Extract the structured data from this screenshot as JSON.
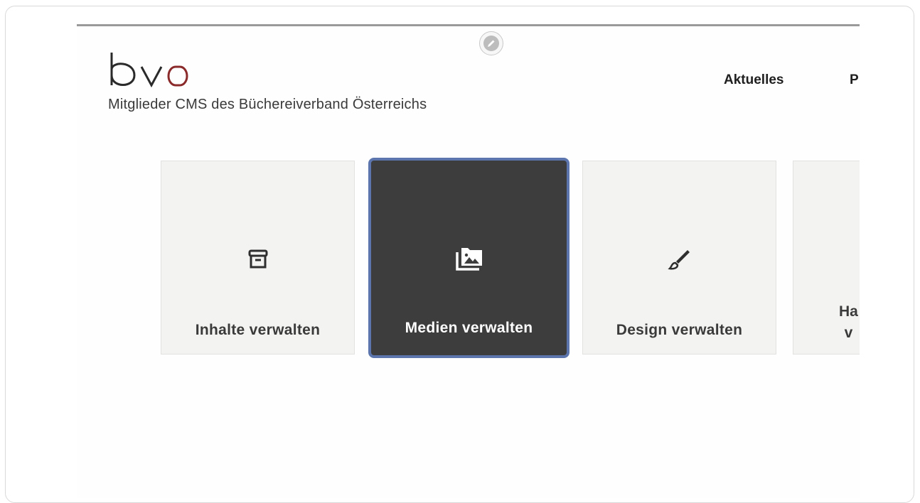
{
  "header": {
    "logo_text": "bvö",
    "subtitle": "Mitglieder CMS des Büchereiverband Österreichs"
  },
  "nav": {
    "items": [
      "Aktuelles",
      "P"
    ]
  },
  "edit_button": {
    "icon": "pencil-icon"
  },
  "tiles": [
    {
      "label": "Inhalte verwalten",
      "icon": "archive-box-icon",
      "selected": false
    },
    {
      "label": "Medien verwalten",
      "icon": "photo-library-icon",
      "selected": true
    },
    {
      "label": "Design verwalten",
      "icon": "paintbrush-icon",
      "selected": false
    },
    {
      "label_line1": "Ha",
      "label_line2": "v",
      "icon": "",
      "selected": false
    }
  ],
  "colors": {
    "selected_tile_bg": "#3d3d3d",
    "selected_tile_border": "#5c76ad",
    "tile_bg": "#f3f3f1",
    "logo_accent": "#8b2a2a"
  }
}
